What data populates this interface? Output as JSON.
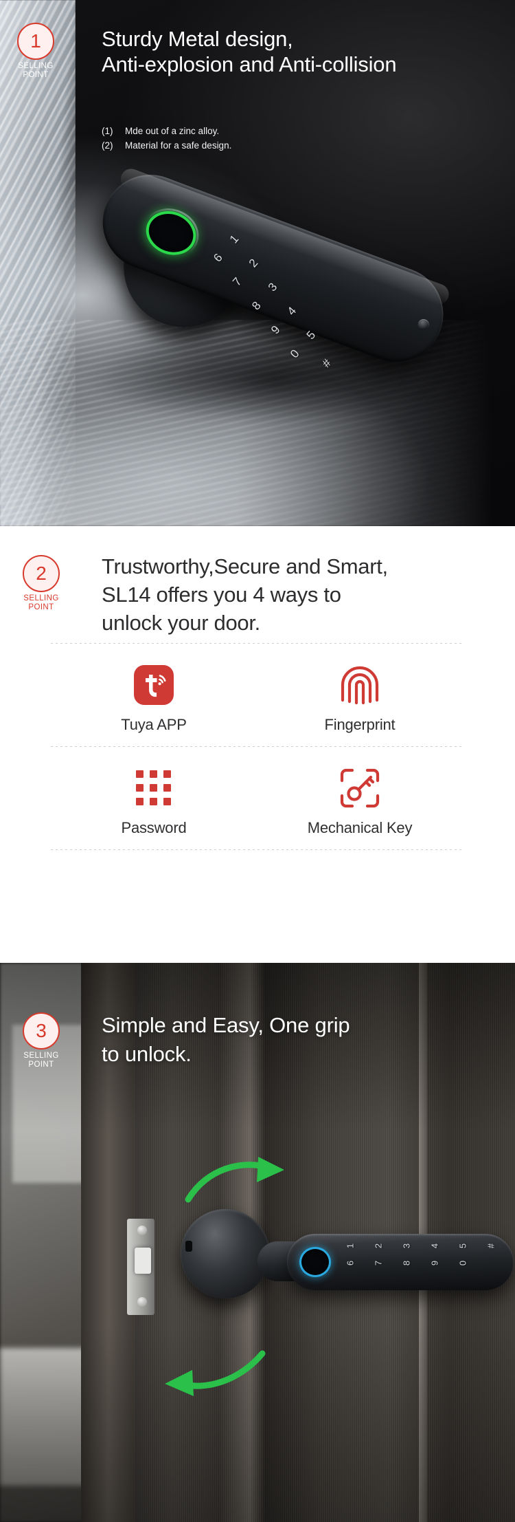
{
  "meta": {
    "accent_red": "#d8392b",
    "accent_green": "#2bc04a",
    "accent_blue": "#2aa9e0",
    "dark_bg": "#0a0a0a",
    "light_bg": "#ffffff",
    "text_dark": "#2d2d2f",
    "text_light": "#ffffff"
  },
  "section1": {
    "badge": {
      "number": "1",
      "label_line1": "SELLING",
      "label_line2": "POINT"
    },
    "title_line1": "Sturdy Metal design,",
    "title_line2": "Anti-explosion and Anti-collision",
    "bullets": [
      {
        "index": "(1)",
        "text": "Mde out of a zinc alloy."
      },
      {
        "index": "(2)",
        "text": "Material for a safe design."
      }
    ],
    "product": {
      "fingerprint_icon": "fingerprint-ring-icon",
      "keypad_columns": [
        {
          "keys": [
            "1",
            "6"
          ]
        },
        {
          "keys": [
            "2",
            "7"
          ]
        },
        {
          "keys": [
            "3",
            "8"
          ]
        },
        {
          "keys": [
            "4",
            "9"
          ]
        },
        {
          "keys": [
            "5",
            "0"
          ]
        },
        {
          "keys": [
            "#"
          ]
        }
      ]
    }
  },
  "section2": {
    "badge": {
      "number": "2",
      "label_line1": "SELLING",
      "label_line2": "POINT"
    },
    "title_line1": "Trustworthy,Secure and Smart,",
    "title_line2": "SL14 offers you 4 ways to",
    "title_line3": "unlock your door.",
    "features": [
      {
        "icon": "tuya-app-icon",
        "label": "Tuya APP"
      },
      {
        "icon": "fingerprint-icon",
        "label": "Fingerprint"
      },
      {
        "icon": "password-grid-icon",
        "label": "Password"
      },
      {
        "icon": "mechanical-key-icon",
        "label": "Mechanical Key"
      }
    ]
  },
  "section3": {
    "badge": {
      "number": "3",
      "label_line1": "SELLING",
      "label_line2": "POINT"
    },
    "title_line1": "Simple and Easy, One grip",
    "title_line2": "to unlock.",
    "arrows": [
      {
        "name": "rotate-up-arrow",
        "direction": "up-right"
      },
      {
        "name": "rotate-down-arrow",
        "direction": "down-left"
      }
    ],
    "product": {
      "fingerprint_icon": "fingerprint-ring-icon",
      "keypad_columns": [
        {
          "keys": [
            "1",
            "6"
          ]
        },
        {
          "keys": [
            "2",
            "7"
          ]
        },
        {
          "keys": [
            "3",
            "8"
          ]
        },
        {
          "keys": [
            "4",
            "9"
          ]
        },
        {
          "keys": [
            "5",
            "0"
          ]
        },
        {
          "keys": [
            "#"
          ]
        }
      ]
    }
  }
}
